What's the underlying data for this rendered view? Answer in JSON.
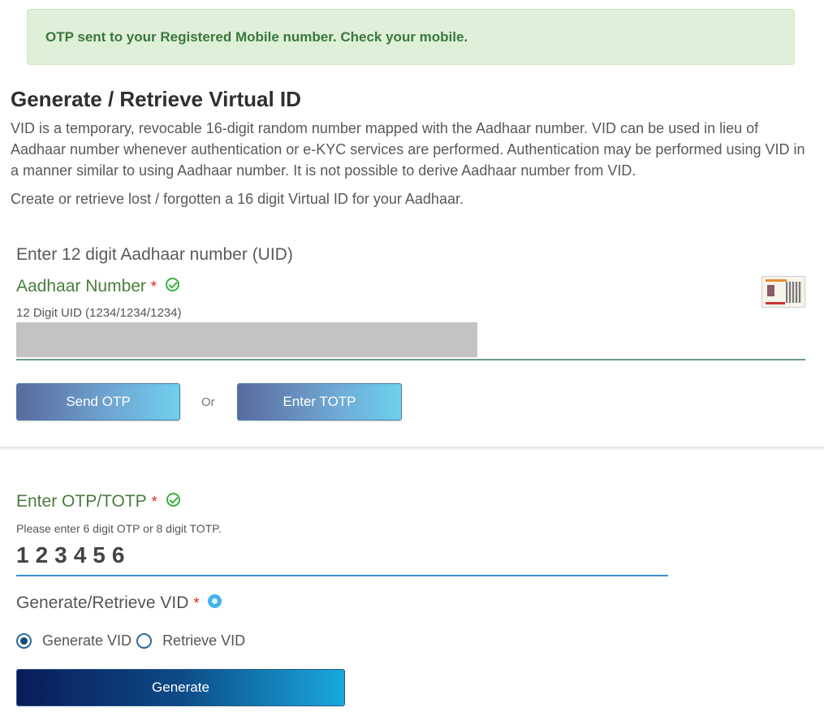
{
  "alert": {
    "message": "OTP sent to your Registered Mobile number. Check your mobile."
  },
  "page": {
    "title": "Generate / Retrieve Virtual ID",
    "description": "VID is a temporary, revocable 16-digit random number mapped with the Aadhaar number. VID can be used in lieu of Aadhaar number whenever authentication or e-KYC services are performed. Authentication may be performed using VID in a manner similar to using Aadhaar number. It is not possible to derive Aadhaar number from VID.",
    "subdescription": "Create or retrieve lost / forgotten a 16 digit Virtual ID for your Aadhaar."
  },
  "uid_section": {
    "heading": "Enter 12 digit Aadhaar number (UID)",
    "label": "Aadhaar Number",
    "required_mark": "*",
    "hint": "12 Digit UID (1234/1234/1234)",
    "send_otp_label": "Send OTP",
    "or_label": "Or",
    "enter_totp_label": "Enter TOTP"
  },
  "otp_section": {
    "label": "Enter OTP/TOTP",
    "required_mark": "*",
    "hint": "Please enter 6 digit OTP or 8 digit TOTP.",
    "value": "123456"
  },
  "vid_section": {
    "label": "Generate/Retrieve VID",
    "required_mark": "*",
    "options": [
      {
        "label": "Generate VID",
        "selected": true
      },
      {
        "label": "Retrieve VID",
        "selected": false
      }
    ],
    "submit_label": "Generate"
  },
  "colors": {
    "alert_bg": "#dff0d8",
    "alert_text": "#3c763d",
    "label_green": "#4a7c3f",
    "required_red": "#e02020",
    "check_green": "#3cb043",
    "info_blue": "#41b5ec"
  },
  "icons": [
    "check-circle-icon",
    "aadhaar-card-icon",
    "info-icon"
  ]
}
